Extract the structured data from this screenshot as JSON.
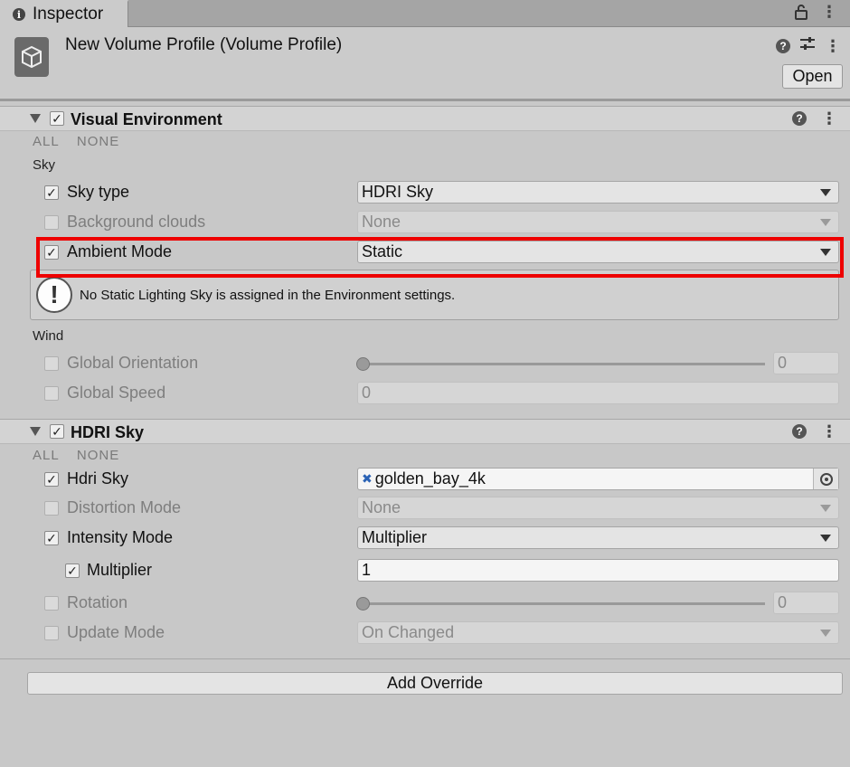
{
  "tab": {
    "title": "Inspector"
  },
  "header": {
    "title": "New Volume Profile (Volume Profile)",
    "open_label": "Open"
  },
  "sections": {
    "visual_env": {
      "title": "Visual Environment",
      "all": "ALL",
      "none": "NONE",
      "group_sky": "Sky",
      "sky_type": {
        "label": "Sky type",
        "value": "HDRI Sky"
      },
      "background_clouds": {
        "label": "Background clouds",
        "value": "None"
      },
      "ambient_mode": {
        "label": "Ambient Mode",
        "value": "Static"
      },
      "help_message": "No Static Lighting Sky is assigned in the Environment settings.",
      "group_wind": "Wind",
      "global_orientation": {
        "label": "Global Orientation",
        "value": "0"
      },
      "global_speed": {
        "label": "Global Speed",
        "value": "0"
      }
    },
    "hdri_sky": {
      "title": "HDRI Sky",
      "all": "ALL",
      "none": "NONE",
      "hdri_sky": {
        "label": "Hdri Sky",
        "value": "golden_bay_4k"
      },
      "distortion_mode": {
        "label": "Distortion Mode",
        "value": "None"
      },
      "intensity_mode": {
        "label": "Intensity Mode",
        "value": "Multiplier"
      },
      "multiplier": {
        "label": "Multiplier",
        "value": "1"
      },
      "rotation": {
        "label": "Rotation",
        "value": "0"
      },
      "update_mode": {
        "label": "Update Mode",
        "value": "On Changed"
      }
    }
  },
  "add_override_label": "Add Override",
  "checkmark": "✓",
  "colors": {
    "highlight": "#ee0000"
  }
}
